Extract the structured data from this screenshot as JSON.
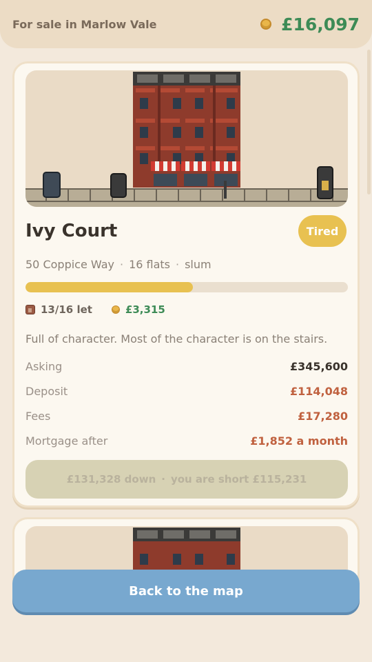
{
  "header": {
    "location_title": "For sale in Marlow Vale",
    "balance": "£16,097",
    "coin_icon": "coin-icon"
  },
  "property": {
    "name": "Ivy Court",
    "condition_badge": "Tired",
    "address": "50 Coppice Way",
    "flats": "16 flats",
    "tier": "slum",
    "occupancy_fraction": 0.52,
    "let_text": "13/16 let",
    "income": "£3,315",
    "flavor": "Full of character. Most of the character is on the stairs.",
    "rows": [
      {
        "label": "Asking",
        "value": "£345,600"
      },
      {
        "label": "Deposit",
        "value": "£114,048"
      },
      {
        "label": "Fees",
        "value": "£17,280"
      },
      {
        "label": "Mortgage after",
        "value": "£1,852 a month"
      }
    ],
    "buy_down": "£131,328 down",
    "buy_short": "you are short £115,231"
  },
  "footer": {
    "back_label": "Back to the map"
  },
  "colors": {
    "accent_green": "#3d8b56",
    "badge_yellow": "#e8c151",
    "cost_red": "#c0613f",
    "button_blue": "#78a8cf"
  }
}
